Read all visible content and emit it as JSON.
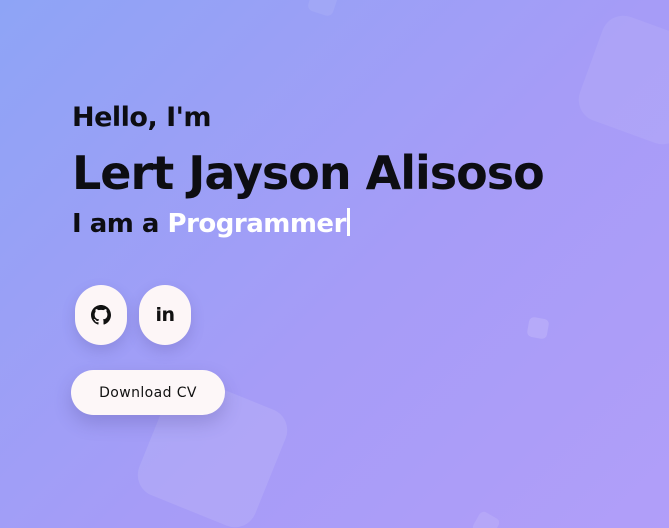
{
  "hero": {
    "greeting": "Hello, I'm",
    "name": "Lert Jayson Alisoso",
    "role_prefix": "I am a",
    "role": "Programmer"
  },
  "socials": [
    {
      "icon": "github-icon"
    },
    {
      "icon": "linkedin-icon",
      "glyph": "in"
    }
  ],
  "actions": {
    "download_cv_label": "Download CV"
  },
  "colors": {
    "gradient_start": "#8ea4f6",
    "gradient_end": "#b19ef9",
    "text": "#0d0d12",
    "role_highlight": "#ffffff",
    "button_bg": "#fdf7f8"
  }
}
